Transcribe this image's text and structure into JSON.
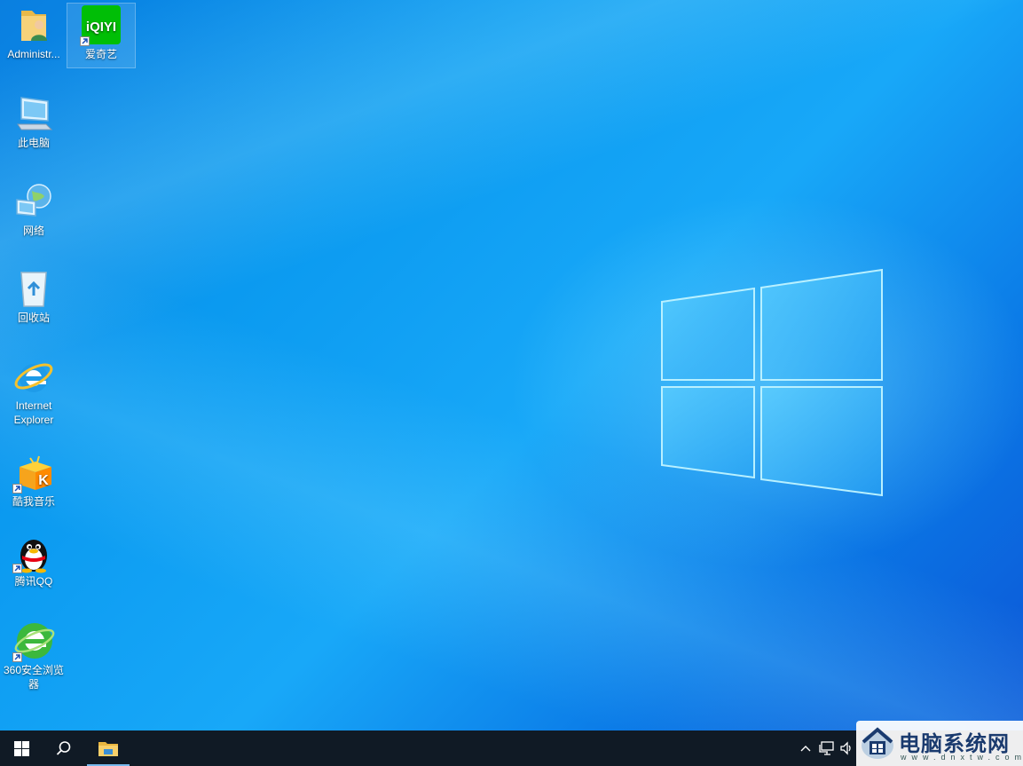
{
  "desktop": {
    "icons": [
      {
        "label": "Administr..."
      },
      {
        "label": "爱奇艺",
        "logo_text": "iQIYI"
      },
      {
        "label": "此电脑"
      },
      {
        "label": "网络"
      },
      {
        "label": "回收站"
      },
      {
        "label_line1": "Internet",
        "label_line2": "Explorer"
      },
      {
        "label": "酷我音乐"
      },
      {
        "label": "腾讯QQ"
      },
      {
        "label_line1": "360安全浏览",
        "label_line2": "器"
      }
    ]
  },
  "taskbar": {
    "start_icon": "windows-start-icon",
    "search_icon": "search-icon",
    "pinned": [
      {
        "icon": "file-explorer-icon",
        "active": true
      }
    ],
    "tray_icons": [
      "chevron-up-icon",
      "network-icon",
      "volume-icon"
    ]
  },
  "watermark": {
    "title": "电脑系统网",
    "url": "www.dnxtw.com"
  },
  "colors": {
    "taskbar": "#101a25",
    "accent": "#76b9ed",
    "desktop_blue": "#0b9af0"
  }
}
